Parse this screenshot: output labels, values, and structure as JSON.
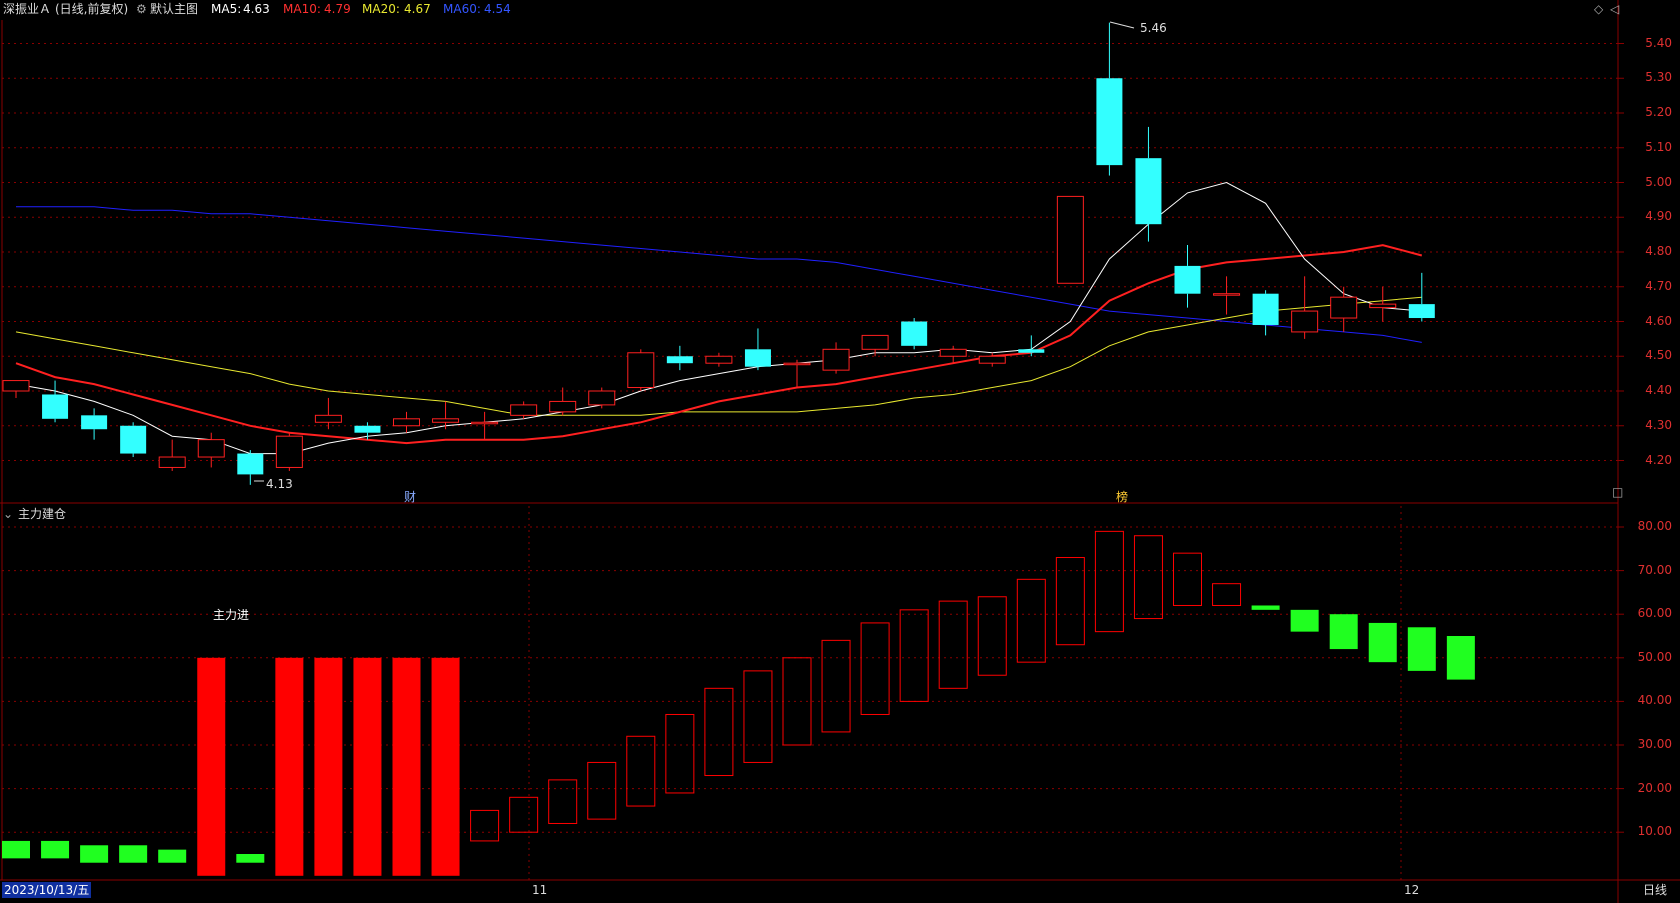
{
  "header": {
    "stock": "深振业Ａ",
    "mode": "(日线,前复权)",
    "template": "默认主图",
    "ma5_label": "MA5:",
    "ma5_value": "4.63",
    "ma10_label": "MA10:",
    "ma10_value": "4.79",
    "ma20_label": "MA20:",
    "ma20_value": "4.67",
    "ma60_label": "MA60:",
    "ma60_value": "4.54"
  },
  "colors": {
    "up": "#ff2020",
    "down": "#33ffff",
    "ma5": "#ffffff",
    "ma10": "#ff2020",
    "ma20": "#e8e830",
    "ma60": "#2020ff",
    "bar_up": "#ff0000",
    "bar_down": "#20ff20",
    "grid": "#8a0000"
  },
  "price_axis": [
    "5.40",
    "5.30",
    "5.20",
    "5.10",
    "5.00",
    "4.90",
    "4.80",
    "4.70",
    "4.60",
    "4.50",
    "4.40",
    "4.30",
    "4.20"
  ],
  "sub_axis": [
    "80.00",
    "70.00",
    "60.00",
    "50.00",
    "40.00",
    "30.00",
    "20.00",
    "10.00"
  ],
  "annotations": {
    "high": "5.46",
    "low": "4.13",
    "finance_mark": "财",
    "list_mark": "榜",
    "main_in": "主力进"
  },
  "sub_panel": {
    "title": "主力建仓"
  },
  "footer": {
    "date": "2023/10/13/五",
    "month_11": "11",
    "month_12": "12",
    "period": "日线"
  },
  "chart_data": {
    "type": "candlestick",
    "candles": [
      {
        "o": 4.4,
        "h": 4.43,
        "l": 4.38,
        "c": 4.43
      },
      {
        "o": 4.39,
        "h": 4.43,
        "l": 4.31,
        "c": 4.32
      },
      {
        "o": 4.33,
        "h": 4.35,
        "l": 4.26,
        "c": 4.29
      },
      {
        "o": 4.3,
        "h": 4.31,
        "l": 4.21,
        "c": 4.22
      },
      {
        "o": 4.18,
        "h": 4.26,
        "l": 4.17,
        "c": 4.21
      },
      {
        "o": 4.21,
        "h": 4.28,
        "l": 4.18,
        "c": 4.26
      },
      {
        "o": 4.22,
        "h": 4.23,
        "l": 4.13,
        "c": 4.16
      },
      {
        "o": 4.18,
        "h": 4.28,
        "l": 4.17,
        "c": 4.27
      },
      {
        "o": 4.31,
        "h": 4.38,
        "l": 4.29,
        "c": 4.33
      },
      {
        "o": 4.3,
        "h": 4.31,
        "l": 4.26,
        "c": 4.28
      },
      {
        "o": 4.3,
        "h": 4.34,
        "l": 4.28,
        "c": 4.32
      },
      {
        "o": 4.31,
        "h": 4.37,
        "l": 4.29,
        "c": 4.32
      },
      {
        "o": 4.31,
        "h": 4.34,
        "l": 4.26,
        "c": 4.31
      },
      {
        "o": 4.33,
        "h": 4.37,
        "l": 4.32,
        "c": 4.36
      },
      {
        "o": 4.34,
        "h": 4.41,
        "l": 4.33,
        "c": 4.37
      },
      {
        "o": 4.36,
        "h": 4.41,
        "l": 4.35,
        "c": 4.4
      },
      {
        "o": 4.41,
        "h": 4.52,
        "l": 4.4,
        "c": 4.51
      },
      {
        "o": 4.5,
        "h": 4.53,
        "l": 4.46,
        "c": 4.48
      },
      {
        "o": 4.48,
        "h": 4.51,
        "l": 4.47,
        "c": 4.5
      },
      {
        "o": 4.52,
        "h": 4.58,
        "l": 4.46,
        "c": 4.47
      },
      {
        "o": 4.48,
        "h": 4.49,
        "l": 4.41,
        "c": 4.48
      },
      {
        "o": 4.46,
        "h": 4.54,
        "l": 4.45,
        "c": 4.52
      },
      {
        "o": 4.52,
        "h": 4.55,
        "l": 4.5,
        "c": 4.56
      },
      {
        "o": 4.6,
        "h": 4.61,
        "l": 4.52,
        "c": 4.53
      },
      {
        "o": 4.5,
        "h": 4.53,
        "l": 4.48,
        "c": 4.52
      },
      {
        "o": 4.48,
        "h": 4.51,
        "l": 4.47,
        "c": 4.5
      },
      {
        "o": 4.52,
        "h": 4.56,
        "l": 4.5,
        "c": 4.51
      },
      {
        "o": 4.71,
        "h": 4.96,
        "l": 4.71,
        "c": 4.96
      },
      {
        "o": 5.3,
        "h": 5.46,
        "l": 5.02,
        "c": 5.05
      },
      {
        "o": 5.07,
        "h": 5.16,
        "l": 4.83,
        "c": 4.88
      },
      {
        "o": 4.76,
        "h": 4.82,
        "l": 4.64,
        "c": 4.68
      },
      {
        "o": 4.68,
        "h": 4.73,
        "l": 4.62,
        "c": 4.68
      },
      {
        "o": 4.68,
        "h": 4.69,
        "l": 4.56,
        "c": 4.59
      },
      {
        "o": 4.57,
        "h": 4.73,
        "l": 4.55,
        "c": 4.63
      },
      {
        "o": 4.61,
        "h": 4.7,
        "l": 4.57,
        "c": 4.67
      },
      {
        "o": 4.64,
        "h": 4.7,
        "l": 4.6,
        "c": 4.65
      },
      {
        "o": 4.65,
        "h": 4.74,
        "l": 4.6,
        "c": 4.61
      }
    ],
    "ma5": [
      4.42,
      4.4,
      4.37,
      4.33,
      4.27,
      4.26,
      4.22,
      4.22,
      4.25,
      4.27,
      4.28,
      4.3,
      4.31,
      4.32,
      4.34,
      4.36,
      4.4,
      4.43,
      4.45,
      4.47,
      4.48,
      4.49,
      4.51,
      4.51,
      4.52,
      4.51,
      4.52,
      4.6,
      4.78,
      4.88,
      4.97,
      5.0,
      4.94,
      4.78,
      4.68,
      4.64,
      4.63
    ],
    "ma10": [
      4.48,
      4.44,
      4.42,
      4.39,
      4.36,
      4.33,
      4.3,
      4.28,
      4.27,
      4.26,
      4.25,
      4.26,
      4.26,
      4.26,
      4.27,
      4.29,
      4.31,
      4.34,
      4.37,
      4.39,
      4.41,
      4.42,
      4.44,
      4.46,
      4.48,
      4.5,
      4.51,
      4.56,
      4.66,
      4.71,
      4.75,
      4.77,
      4.78,
      4.79,
      4.8,
      4.82,
      4.79
    ],
    "ma20": [
      4.57,
      4.55,
      4.53,
      4.51,
      4.49,
      4.47,
      4.45,
      4.42,
      4.4,
      4.39,
      4.38,
      4.37,
      4.35,
      4.33,
      4.33,
      4.33,
      4.33,
      4.34,
      4.34,
      4.34,
      4.34,
      4.35,
      4.36,
      4.38,
      4.39,
      4.41,
      4.43,
      4.47,
      4.53,
      4.57,
      4.59,
      4.61,
      4.63,
      4.64,
      4.65,
      4.66,
      4.67
    ],
    "ma60": [
      4.93,
      4.93,
      4.93,
      4.92,
      4.92,
      4.91,
      4.91,
      4.9,
      4.89,
      4.88,
      4.87,
      4.86,
      4.85,
      4.84,
      4.83,
      4.82,
      4.81,
      4.8,
      4.79,
      4.78,
      4.78,
      4.77,
      4.75,
      4.73,
      4.71,
      4.69,
      4.67,
      4.65,
      4.63,
      4.62,
      4.61,
      4.6,
      4.59,
      4.58,
      4.57,
      4.56,
      4.54
    ],
    "sub_bars": [
      {
        "v0": 4,
        "v1": 8,
        "kind": "down"
      },
      {
        "v0": 4,
        "v1": 8,
        "kind": "down"
      },
      {
        "v0": 3,
        "v1": 7,
        "kind": "down"
      },
      {
        "v0": 3,
        "v1": 7,
        "kind": "down"
      },
      {
        "v0": 3,
        "v1": 6,
        "kind": "down"
      },
      {
        "v0": 0,
        "v1": 50,
        "kind": "up_solid"
      },
      {
        "v0": 3,
        "v1": 5,
        "kind": "down"
      },
      {
        "v0": 0,
        "v1": 50,
        "kind": "up_solid"
      },
      {
        "v0": 0,
        "v1": 50,
        "kind": "up_solid"
      },
      {
        "v0": 0,
        "v1": 50,
        "kind": "up_solid"
      },
      {
        "v0": 0,
        "v1": 50,
        "kind": "up_solid"
      },
      {
        "v0": 0,
        "v1": 50,
        "kind": "up_solid"
      },
      {
        "v0": 8,
        "v1": 15,
        "kind": "up_hollow"
      },
      {
        "v0": 10,
        "v1": 18,
        "kind": "up_hollow"
      },
      {
        "v0": 12,
        "v1": 22,
        "kind": "up_hollow"
      },
      {
        "v0": 13,
        "v1": 26,
        "kind": "up_hollow"
      },
      {
        "v0": 16,
        "v1": 32,
        "kind": "up_hollow"
      },
      {
        "v0": 19,
        "v1": 37,
        "kind": "up_hollow"
      },
      {
        "v0": 23,
        "v1": 43,
        "kind": "up_hollow"
      },
      {
        "v0": 26,
        "v1": 47,
        "kind": "up_hollow"
      },
      {
        "v0": 30,
        "v1": 50,
        "kind": "up_hollow"
      },
      {
        "v0": 33,
        "v1": 54,
        "kind": "up_hollow"
      },
      {
        "v0": 37,
        "v1": 58,
        "kind": "up_hollow"
      },
      {
        "v0": 40,
        "v1": 61,
        "kind": "up_hollow"
      },
      {
        "v0": 43,
        "v1": 63,
        "kind": "up_hollow"
      },
      {
        "v0": 46,
        "v1": 64,
        "kind": "up_hollow"
      },
      {
        "v0": 49,
        "v1": 68,
        "kind": "up_hollow"
      },
      {
        "v0": 53,
        "v1": 73,
        "kind": "up_hollow"
      },
      {
        "v0": 56,
        "v1": 79,
        "kind": "up_hollow"
      },
      {
        "v0": 59,
        "v1": 78,
        "kind": "up_hollow"
      },
      {
        "v0": 62,
        "v1": 74,
        "kind": "up_hollow"
      },
      {
        "v0": 62,
        "v1": 67,
        "kind": "up_hollow"
      },
      {
        "v0": 61,
        "v1": 62,
        "kind": "down"
      },
      {
        "v0": 56,
        "v1": 61,
        "kind": "down"
      },
      {
        "v0": 52,
        "v1": 60,
        "kind": "down"
      },
      {
        "v0": 49,
        "v1": 58,
        "kind": "down"
      },
      {
        "v0": 47,
        "v1": 57,
        "kind": "down"
      },
      {
        "v0": 45,
        "v1": 55,
        "kind": "down"
      }
    ]
  }
}
